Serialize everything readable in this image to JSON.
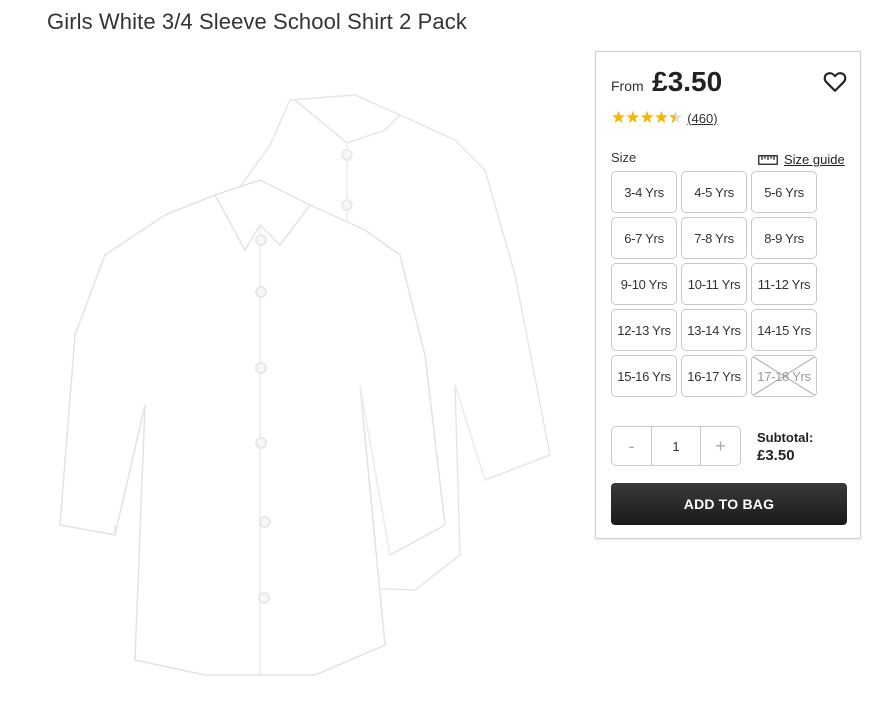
{
  "product": {
    "title": "Girls White 3/4 Sleeve School Shirt 2 Pack"
  },
  "panel": {
    "from_label": "From",
    "price": "£3.50",
    "rating_value": 4.5,
    "review_count": "(460)",
    "size_label": "Size",
    "size_guide_label": "Size guide",
    "sizes": [
      {
        "label": "3-4 Yrs",
        "available": true
      },
      {
        "label": "4-5 Yrs",
        "available": true
      },
      {
        "label": "5-6 Yrs",
        "available": true
      },
      {
        "label": "6-7 Yrs",
        "available": true
      },
      {
        "label": "7-8 Yrs",
        "available": true
      },
      {
        "label": "8-9 Yrs",
        "available": true
      },
      {
        "label": "9-10 Yrs",
        "available": true
      },
      {
        "label": "10-11 Yrs",
        "available": true
      },
      {
        "label": "11-12 Yrs",
        "available": true
      },
      {
        "label": "12-13 Yrs",
        "available": true
      },
      {
        "label": "13-14 Yrs",
        "available": true
      },
      {
        "label": "14-15 Yrs",
        "available": true
      },
      {
        "label": "15-16 Yrs",
        "available": true
      },
      {
        "label": "16-17 Yrs",
        "available": true
      },
      {
        "label": "17-18 Yrs",
        "available": false
      }
    ],
    "quantity": {
      "minus": "-",
      "value": "1",
      "plus": "+"
    },
    "subtotal_label": "Subtotal:",
    "subtotal_value": "£3.50",
    "add_to_bag": "ADD TO BAG"
  },
  "colors": {
    "star": "#f4b400",
    "button_dark": "#222222"
  },
  "icons": {
    "wishlist": "heart-icon",
    "size_guide": "ruler-icon",
    "rating": "star-icon"
  }
}
